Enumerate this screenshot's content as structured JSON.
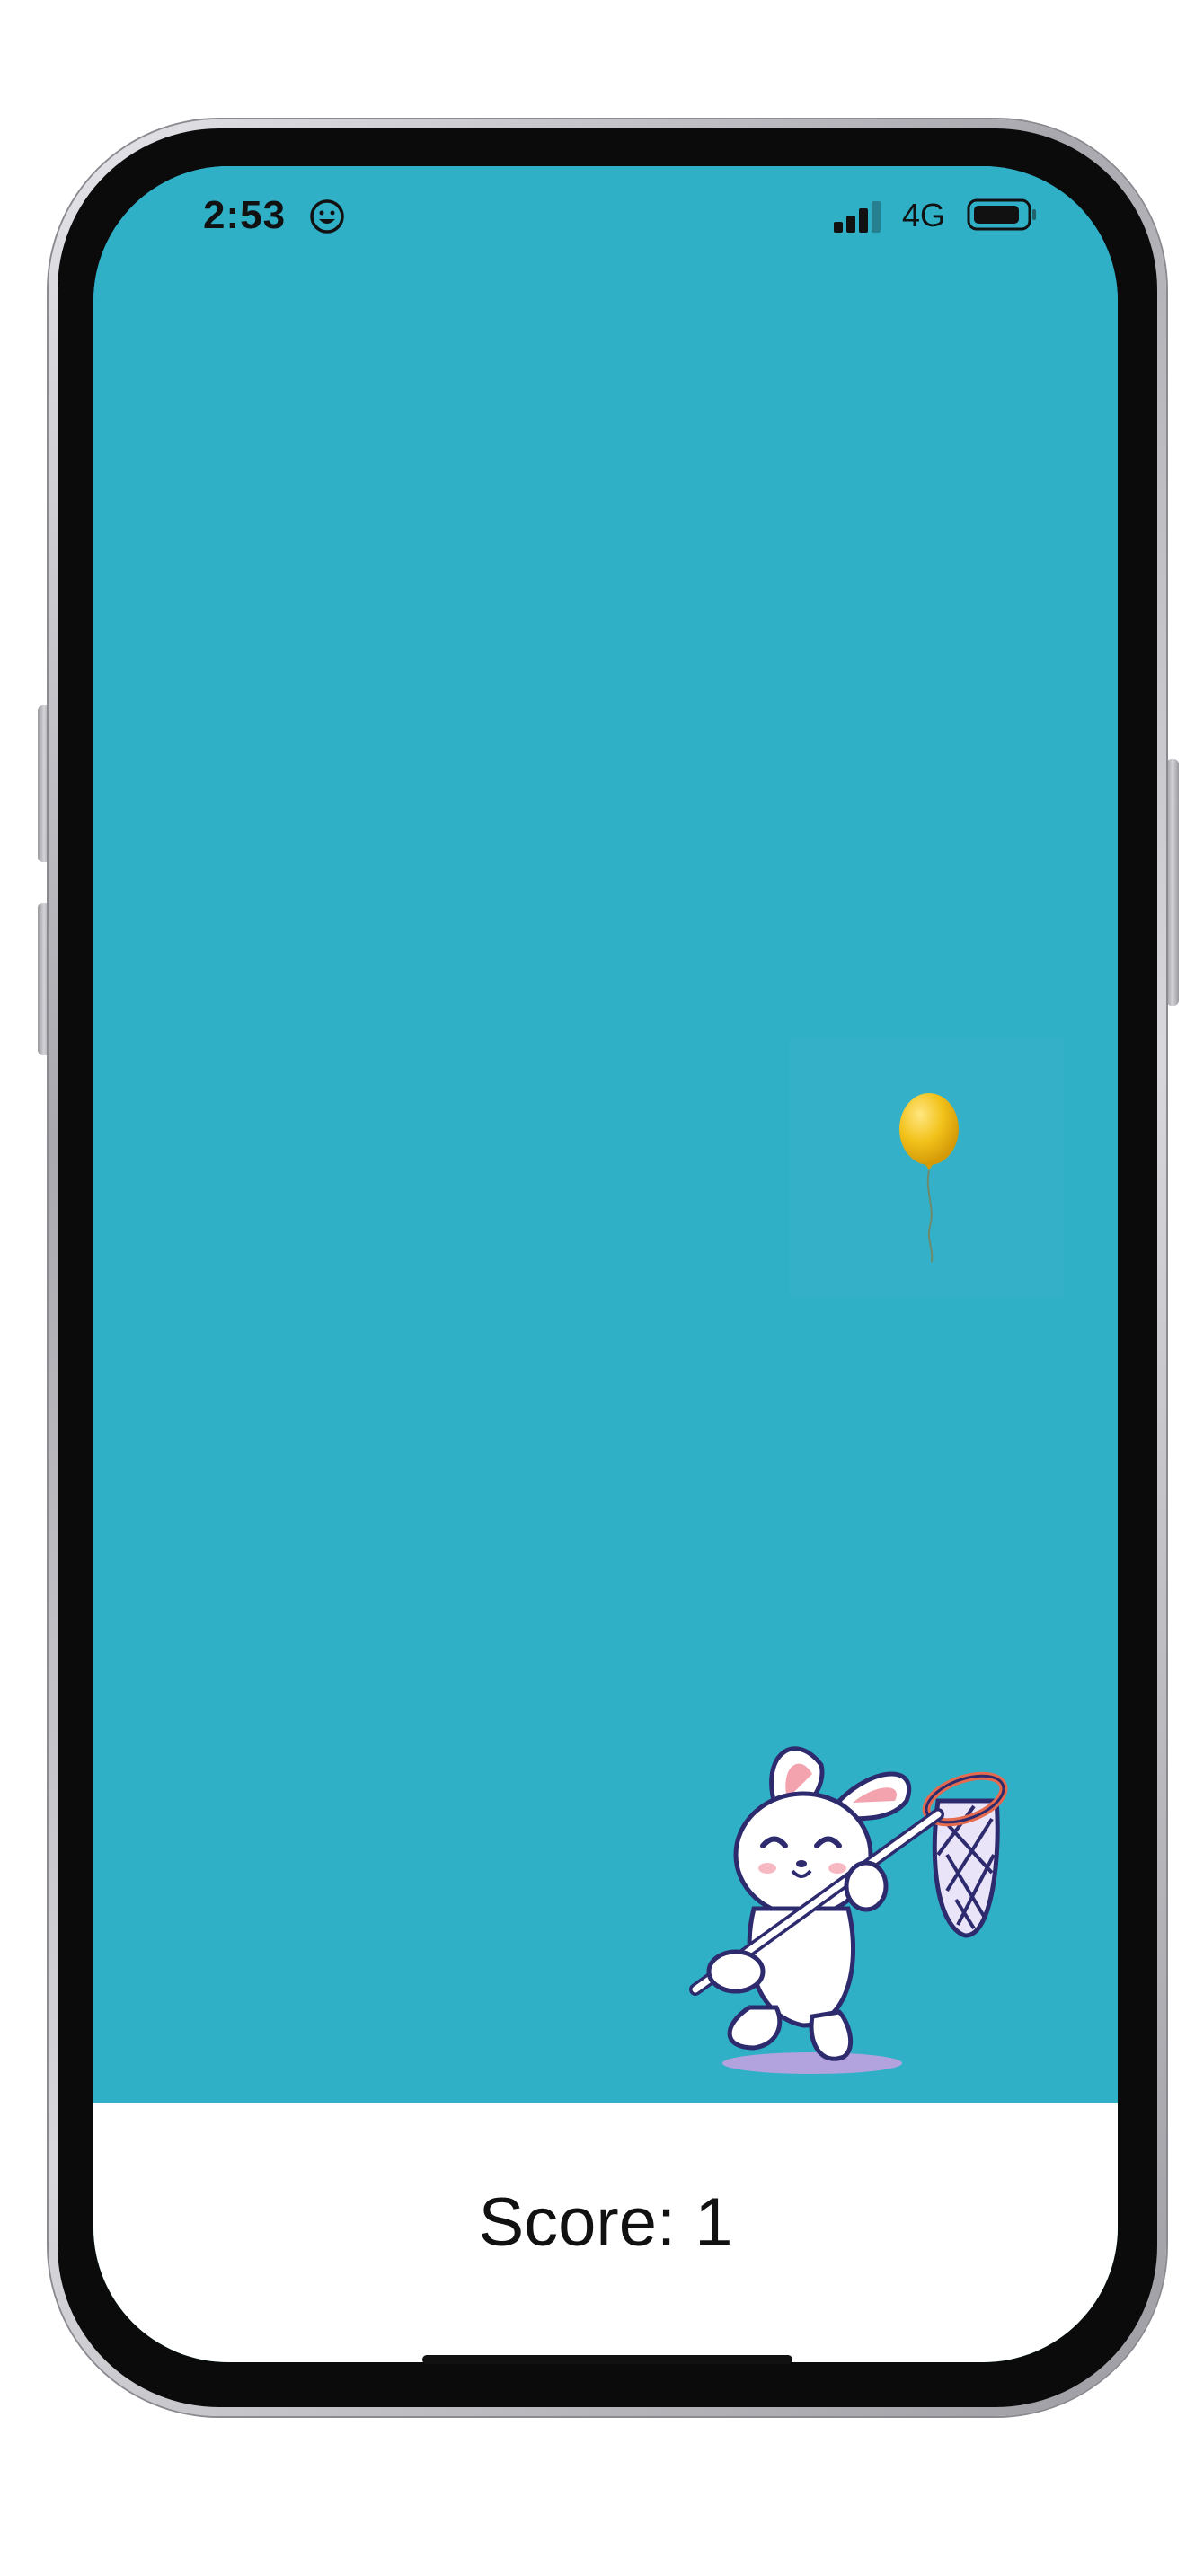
{
  "status_bar": {
    "time": "2:53",
    "network": "4G",
    "icons": [
      "smiley-icon",
      "signal-icon",
      "battery-icon"
    ]
  },
  "game": {
    "background_color": "#30b0c7",
    "balloon_color": "#f2c21a",
    "score_label": "Score: 1"
  }
}
